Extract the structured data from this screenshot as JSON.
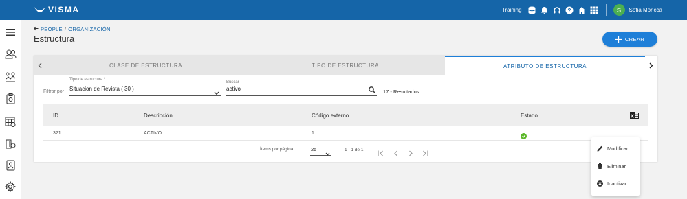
{
  "header": {
    "brand": "VISMA",
    "training_label": "Training",
    "user_initial": "S",
    "user_name": "Sofia Moricca"
  },
  "breadcrumb": {
    "items": [
      "PEOPLE",
      "ORGANIZACIÓN"
    ],
    "separator": "/"
  },
  "page": {
    "title": "Estructura",
    "create_button": "CREAR"
  },
  "tabs": [
    {
      "label": "CLASE DE ESTRUCTURA",
      "active": false
    },
    {
      "label": "TIPO DE ESTRUCTURA",
      "active": false
    },
    {
      "label": "ATRIBUTO DE ESTRUCTURA",
      "active": true
    }
  ],
  "filters": {
    "filter_by_label": "Filtrar por",
    "type_label": "Tipo de estructura *",
    "type_value": "Situacion de Revista ( 30 )",
    "search_label": "Buscar",
    "search_value": "activo",
    "results_text": "17 - Resultados"
  },
  "table": {
    "columns": [
      "ID",
      "Descripción",
      "Código externo",
      "Estado"
    ],
    "rows": [
      {
        "id": "321",
        "descripcion": "ACTIVO",
        "codigo": "1",
        "estado": "active"
      }
    ]
  },
  "pagination": {
    "items_per_page_label": "Ítems por página",
    "page_size": "25",
    "range_text": "1 - 1 de 1"
  },
  "context_menu": {
    "items": [
      "Modificar",
      "Eliminar",
      "Inactivar"
    ]
  },
  "colors": {
    "topbar": "#1565a8",
    "accent": "#1e7fd8",
    "status_ok": "#5cb82a"
  }
}
